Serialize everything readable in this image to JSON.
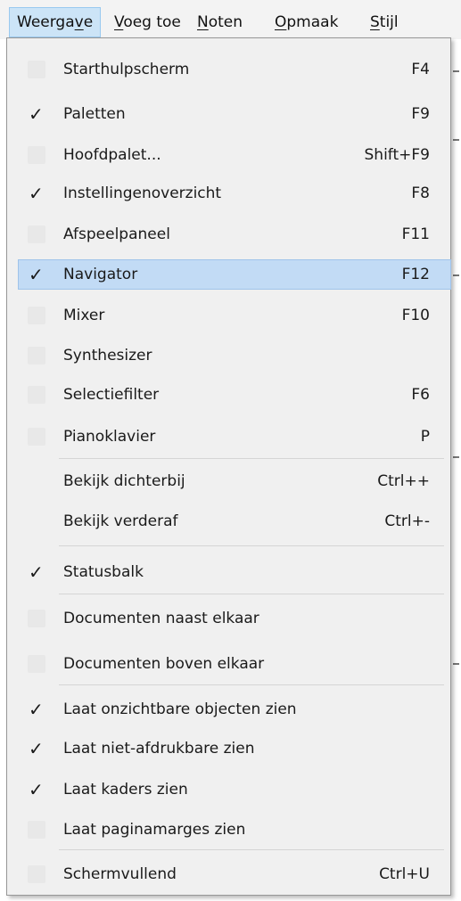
{
  "menubar": {
    "items": [
      {
        "label": "Weergave",
        "key_prefix": "Weerga",
        "key": "v",
        "key_suffix": "e"
      },
      {
        "label": "Voeg toe",
        "key_prefix": "",
        "key": "V",
        "key_suffix": "oeg toe"
      },
      {
        "label": "Noten",
        "key_prefix": "",
        "key": "N",
        "key_suffix": "oten"
      },
      {
        "label": "Opmaak",
        "key_prefix": "",
        "key": "O",
        "key_suffix": "pmaak"
      },
      {
        "label": "Stijl",
        "key_prefix": "",
        "key": "S",
        "key_suffix": "tijl"
      }
    ]
  },
  "menu": {
    "items": [
      {
        "label": "Starthulpscherm",
        "shortcut": "F4",
        "checked": false
      },
      {
        "label": "Paletten",
        "shortcut": "F9",
        "checked": true
      },
      {
        "label": "Hoofdpalet...",
        "shortcut": "Shift+F9",
        "checked": false
      },
      {
        "label": "Instellingenoverzicht",
        "shortcut": "F8",
        "checked": true
      },
      {
        "label": "Afspeelpaneel",
        "shortcut": "F11",
        "checked": false
      },
      {
        "label": "Navigator",
        "shortcut": "F12",
        "checked": true,
        "highlighted": true
      },
      {
        "label": "Mixer",
        "shortcut": "F10",
        "checked": false
      },
      {
        "label": "Synthesizer",
        "shortcut": "",
        "checked": false
      },
      {
        "label": "Selectiefilter",
        "shortcut": "F6",
        "checked": false
      },
      {
        "label": "Pianoklavier",
        "shortcut": "P",
        "checked": false
      },
      {
        "label": "Bekijk dichterbij",
        "shortcut": "Ctrl++"
      },
      {
        "label": "Bekijk verderaf",
        "shortcut": "Ctrl+-"
      },
      {
        "label": "Statusbalk",
        "shortcut": "",
        "checked": true
      },
      {
        "label": "Documenten naast elkaar",
        "shortcut": "",
        "checked": false
      },
      {
        "label": "Documenten boven elkaar",
        "shortcut": "",
        "checked": false
      },
      {
        "label": "Laat onzichtbare objecten zien",
        "shortcut": "",
        "checked": true
      },
      {
        "label": "Laat niet-afdrukbare zien",
        "shortcut": "",
        "checked": true
      },
      {
        "label": "Laat kaders zien",
        "shortcut": "",
        "checked": true
      },
      {
        "label": "Laat paginamarges zien",
        "shortcut": "",
        "checked": false
      },
      {
        "label": "Schermvullend",
        "shortcut": "Ctrl+U",
        "checked": false
      }
    ]
  },
  "icons": {
    "check": "check-mark-icon"
  },
  "colors": {
    "highlight": "#c2dbf5",
    "menubar_active": "#cce4f7",
    "menu_background": "#f0f0f0"
  }
}
